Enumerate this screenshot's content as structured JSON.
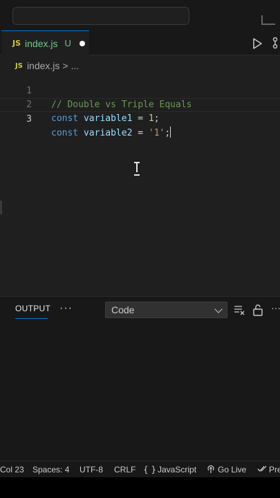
{
  "tab": {
    "icon": "JS",
    "filename": "index.js",
    "status": "U"
  },
  "breadcrumb": {
    "icon": "JS",
    "file": "index.js",
    "separator": ">",
    "more": "..."
  },
  "editor": {
    "lines": [
      {
        "number": "1",
        "comment": "// Double vs Triple Equals"
      },
      {
        "number": "2",
        "keyword": "const",
        "name": "variable1",
        "op": "=",
        "value": "1",
        "end": ";"
      },
      {
        "number": "3",
        "keyword": "const",
        "name": "variable2",
        "op": "=",
        "value": "'1'",
        "end": ";"
      }
    ]
  },
  "panel": {
    "tab_label": "OUTPUT",
    "more": "···",
    "channel_selected": "Code"
  },
  "statusbar": {
    "position": "Col 23",
    "spaces": "Spaces: 4",
    "encoding": "UTF-8",
    "eol": "CRLF",
    "language_icon": "{ }",
    "language": "JavaScript",
    "golive": "Go Live",
    "prettier": "Pre"
  },
  "colors": {
    "accent": "#0078d4",
    "untracked": "#73c991",
    "js_icon": "#cbcb41",
    "comment": "#6a9955",
    "keyword": "#569cd6",
    "variable": "#9cdcfe",
    "number": "#b5cea8",
    "string": "#ce9178"
  }
}
